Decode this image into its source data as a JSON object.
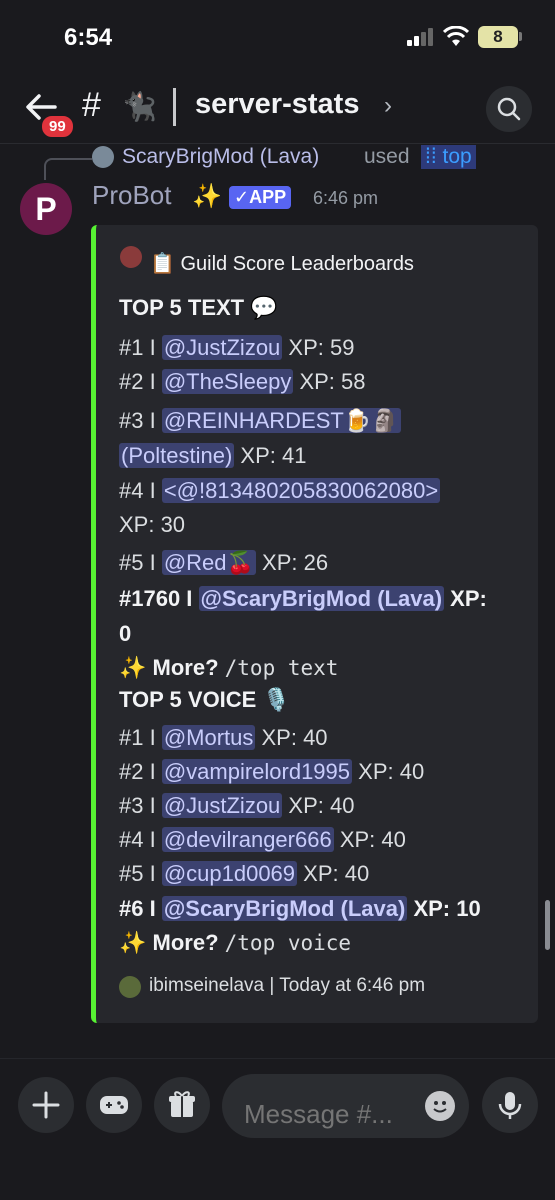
{
  "status_bar": {
    "time": "6:54",
    "battery": "8"
  },
  "header": {
    "back_badge": "99",
    "hash": "#",
    "channel_emoji": "🐈‍⬛",
    "channel_name": "server-stats",
    "chevron": "›"
  },
  "reply": {
    "user": "ScaryBrigMod (Lava)",
    "verb": "used",
    "command": "top"
  },
  "message": {
    "avatar_letter": "P",
    "author": "ProBot",
    "author_emoji": "✨",
    "app_badge": "✓APP",
    "timestamp": "6:46 pm"
  },
  "embed": {
    "author": "📋 Guild Score Leaderboards",
    "text_heading": "TOP 5 TEXT 💬",
    "text_rows": [
      {
        "rank": "#1 I ",
        "user": "@JustZizou",
        "xp": " XP: 59"
      },
      {
        "rank": "#2 I ",
        "user": "@TheSleepy",
        "xp": " XP: 58"
      },
      {
        "rank": "#3 I ",
        "user": "@REINHARDEST🍺🗿",
        "xp": ""
      },
      {
        "rank": "",
        "user": "(Poltestine)",
        "xp": " XP: 41"
      },
      {
        "rank": "#4 I ",
        "user": "<@!813480205830062080>",
        "xp": ""
      },
      {
        "rank": "",
        "user": "",
        "xp": "XP: 30"
      },
      {
        "rank": "#5 I ",
        "user": "@Red🍒",
        "xp": " XP: 26"
      }
    ],
    "text_self": {
      "rank": "#1760 I ",
      "user": "@ScaryBrigMod (Lava)",
      "xp": " XP:",
      "xp_wrap": "0"
    },
    "text_more": {
      "icon": "✨",
      "label": " More? ",
      "cmd": "/top text"
    },
    "voice_heading": "TOP 5 VOICE 🎙️",
    "voice_rows": [
      {
        "rank": "#1 I ",
        "user": "@Mortus",
        "xp": " XP: 40"
      },
      {
        "rank": "#2 I ",
        "user": "@vampirelord1995",
        "xp": " XP: 40"
      },
      {
        "rank": "#3 I ",
        "user": "@JustZizou",
        "xp": " XP: 40"
      },
      {
        "rank": "#4 I ",
        "user": "@devilranger666",
        "xp": " XP: 40"
      },
      {
        "rank": "#5 I ",
        "user": "@cup1d0069",
        "xp": " XP: 40"
      }
    ],
    "voice_self": {
      "rank": "#6 I ",
      "user": "@ScaryBrigMod (Lava)",
      "xp": " XP: 10"
    },
    "voice_more": {
      "icon": "✨",
      "label": " More? ",
      "cmd": "/top voice"
    },
    "footer": "ibimseinelava | Today at 6:46 pm"
  },
  "composer": {
    "placeholder": "Message #..."
  },
  "icons": {
    "back": "back-arrow-icon",
    "search": "search-icon",
    "plus": "plus-icon",
    "games": "gamepad-icon",
    "gift": "gift-icon",
    "emoji": "emoji-icon",
    "mic": "microphone-icon"
  },
  "colors": {
    "embed_accent": "#57f233",
    "mention_bg": "#3c4270",
    "app_badge": "#5865f2",
    "unread_badge": "#e0333c"
  }
}
